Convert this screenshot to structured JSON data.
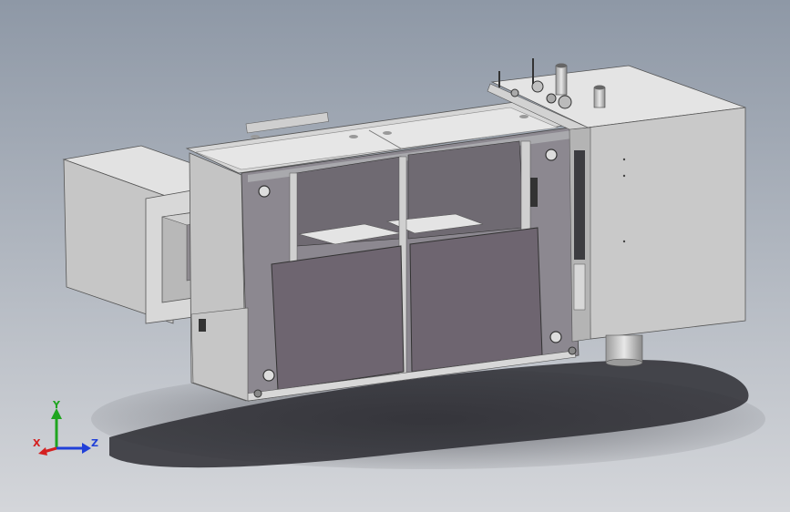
{
  "triad": {
    "x_label": "X",
    "y_label": "Y",
    "z_label": "Z"
  },
  "colors": {
    "background_top": "#8e98a6",
    "background_bottom": "#d4d6da",
    "housing_light": "#dcdcdc",
    "housing_mid": "#c8c8c8",
    "housing_dark": "#b4b4b4",
    "panel_dark": "#6e6570",
    "panel_darker": "#5e5660",
    "frame_gray": "#9a9aa0",
    "shadow": "#2a2a30",
    "axis_x": "#d42020",
    "axis_y": "#1fa51f",
    "axis_z": "#2040d8"
  },
  "icons": [
    "cad-model-icon",
    "axis-triad-icon"
  ]
}
